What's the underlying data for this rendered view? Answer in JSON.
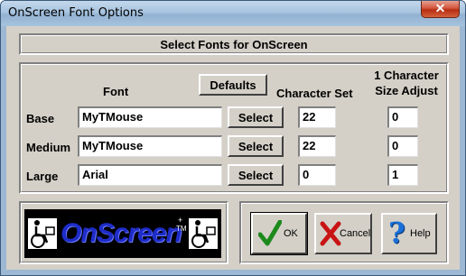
{
  "window": {
    "title": "OnScreen Font Options",
    "close_label": "✕"
  },
  "header": {
    "title": "Select Fonts for OnScreen"
  },
  "columns": {
    "font": "Font",
    "defaults_button": "Defaults",
    "character_set": "Character Set",
    "size_adjust_line1": "1 Character",
    "size_adjust_line2": "Size Adjust"
  },
  "rows": [
    {
      "label": "Base",
      "font": "MyTMouse",
      "select": "Select",
      "charset": "22",
      "size_adjust": "0"
    },
    {
      "label": "Medium",
      "font": "MyTMouse",
      "select": "Select",
      "charset": "22",
      "size_adjust": "0"
    },
    {
      "label": "Large",
      "font": "Arial",
      "select": "Select",
      "charset": "0",
      "size_adjust": "1"
    }
  ],
  "logo": {
    "text": "OnScreen",
    "tm": "TM",
    "plus": "+"
  },
  "buttons": {
    "ok": "OK",
    "cancel": "Cancel",
    "help": "Help"
  },
  "colors": {
    "logo_blue": "#1e2cc8",
    "ok_check": "#1c8a1c",
    "cancel_x": "#c81414",
    "help_q": "#1a6fd8"
  },
  "icons": {
    "ok": "checkmark-icon",
    "cancel": "red-x-icon",
    "help": "question-mark-icon",
    "logo": "wheelchair-user-icon"
  }
}
